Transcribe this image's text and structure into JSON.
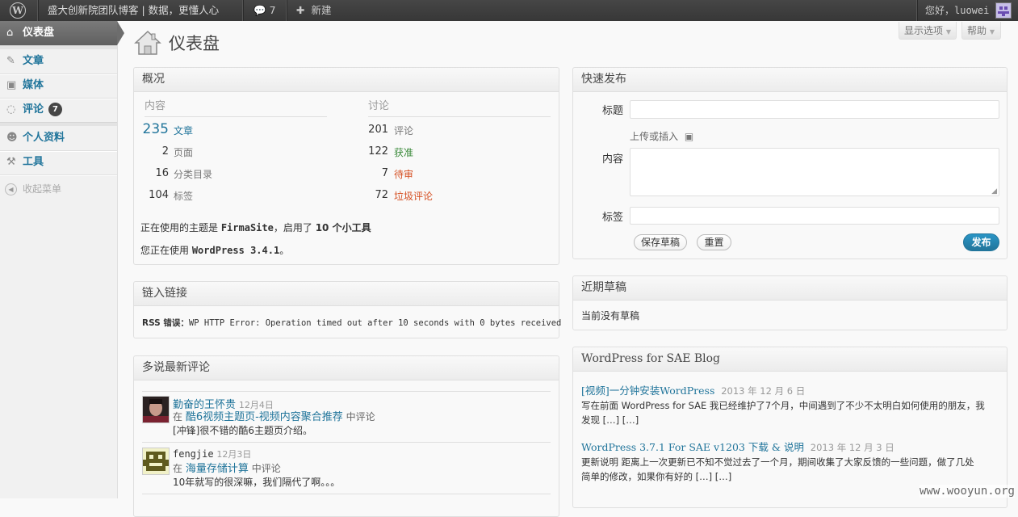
{
  "adminbar": {
    "site_name": "盛大创新院团队博客 | 数据，更懂人心",
    "comments_count": "7",
    "new_label": "新建",
    "greeting": "您好，luowei"
  },
  "menu": {
    "dashboard": "仪表盘",
    "posts": "文章",
    "media": "媒体",
    "comments": "评论",
    "comments_badge": "7",
    "profile": "个人资料",
    "tools": "工具",
    "collapse": "收起菜单"
  },
  "header": {
    "title": "仪表盘",
    "screen_options": "显示选项",
    "help": "帮助"
  },
  "overview": {
    "title": "概况",
    "content_heading": "内容",
    "discussion_heading": "讨论",
    "content": [
      {
        "count": "235",
        "label": "文章"
      },
      {
        "count": "2",
        "label": "页面"
      },
      {
        "count": "16",
        "label": "分类目录"
      },
      {
        "count": "104",
        "label": "标签"
      }
    ],
    "discussion": [
      {
        "count": "201",
        "label": "评论"
      },
      {
        "count": "122",
        "label": "获准"
      },
      {
        "count": "7",
        "label": "待审"
      },
      {
        "count": "72",
        "label": "垃圾评论"
      }
    ],
    "theme_prefix": "正在使用的主题是 ",
    "theme_name": "FirmaSite",
    "theme_middle": "，启用了 ",
    "widgets_link": "10 个小工具",
    "version_prefix": "您正在使用 ",
    "version": "WordPress 3.4.1",
    "version_suffix": "。"
  },
  "incoming_links": {
    "title": "链入链接",
    "error_label": "RSS 错误：",
    "error_text": "WP HTTP Error: Operation timed out after 10 seconds with 0 bytes received"
  },
  "duoshuo": {
    "title": "多说最新评论",
    "comments": [
      {
        "author": "勤奋的王怀贵",
        "date": "12月4日",
        "in_label": "在",
        "post": "酷6视频主题页-视频内容聚合推荐",
        "suffix": "中评论",
        "text": "[冲锋]很不错的酷6主题页介绍。"
      },
      {
        "author": "fengjie",
        "date": "12月3日",
        "in_label": "在",
        "post": "海量存储计算",
        "suffix": "中评论",
        "text": "10年就写的很深嘛，我们隔代了啊。。。"
      }
    ]
  },
  "quick_press": {
    "title": "快速发布",
    "title_label": "标题",
    "upload_label": "上传或插入",
    "content_label": "内容",
    "tags_label": "标签",
    "save_draft": "保存草稿",
    "reset": "重置",
    "publish": "发布"
  },
  "recent_drafts": {
    "title": "近期草稿",
    "empty": "当前没有草稿"
  },
  "sae_blog": {
    "title": "WordPress for SAE Blog",
    "items": [
      {
        "title": "[视频]一分钟安装WordPress",
        "date": "2013 年 12 月 6 日",
        "excerpt_line1": "写在前面 WordPress for SAE 我已经维护了7个月，中间遇到了不少不太明白如何使用的朋友，我",
        "excerpt_line2": "发现 […] […]"
      },
      {
        "title": "WordPress 3.7.1 For SAE v1203 下载 & 说明",
        "date": "2013 年 12 月 3 日",
        "excerpt_line1": "更新说明 距离上一次更新已不知不觉过去了一个月，期间收集了大家反馈的一些问题，做了几处",
        "excerpt_line2": "简单的修改，如果你有好的 […] […]"
      }
    ]
  },
  "watermark": "www.wooyun.org"
}
